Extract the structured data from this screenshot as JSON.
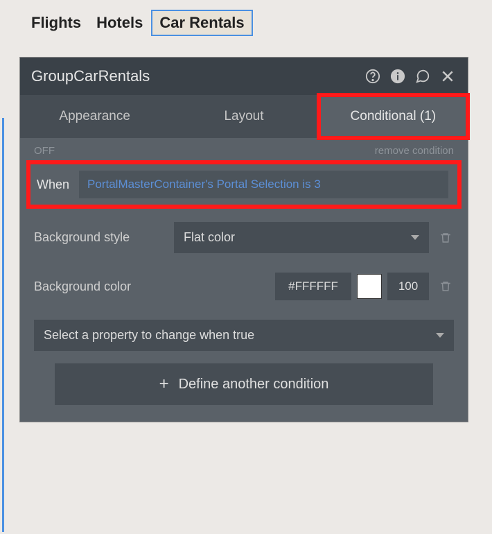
{
  "topTabs": {
    "flights": "Flights",
    "hotels": "Hotels",
    "carRentals": "Car Rentals"
  },
  "panel": {
    "title": "GroupCarRentals",
    "tabs": {
      "appearance": "Appearance",
      "layout": "Layout",
      "conditional": "Conditional (1)"
    },
    "offLabel": "OFF",
    "removeCondition": "remove condition",
    "whenLabel": "When",
    "whenExpression": "PortalMasterContainer's Portal Selection is 3",
    "bgStyleLabel": "Background style",
    "bgStyleValue": "Flat color",
    "bgColorLabel": "Background color",
    "bgColorHex": "#FFFFFF",
    "bgColorAlpha": "100",
    "selectProperty": "Select a property to change when true",
    "defineAnother": "Define another condition"
  }
}
